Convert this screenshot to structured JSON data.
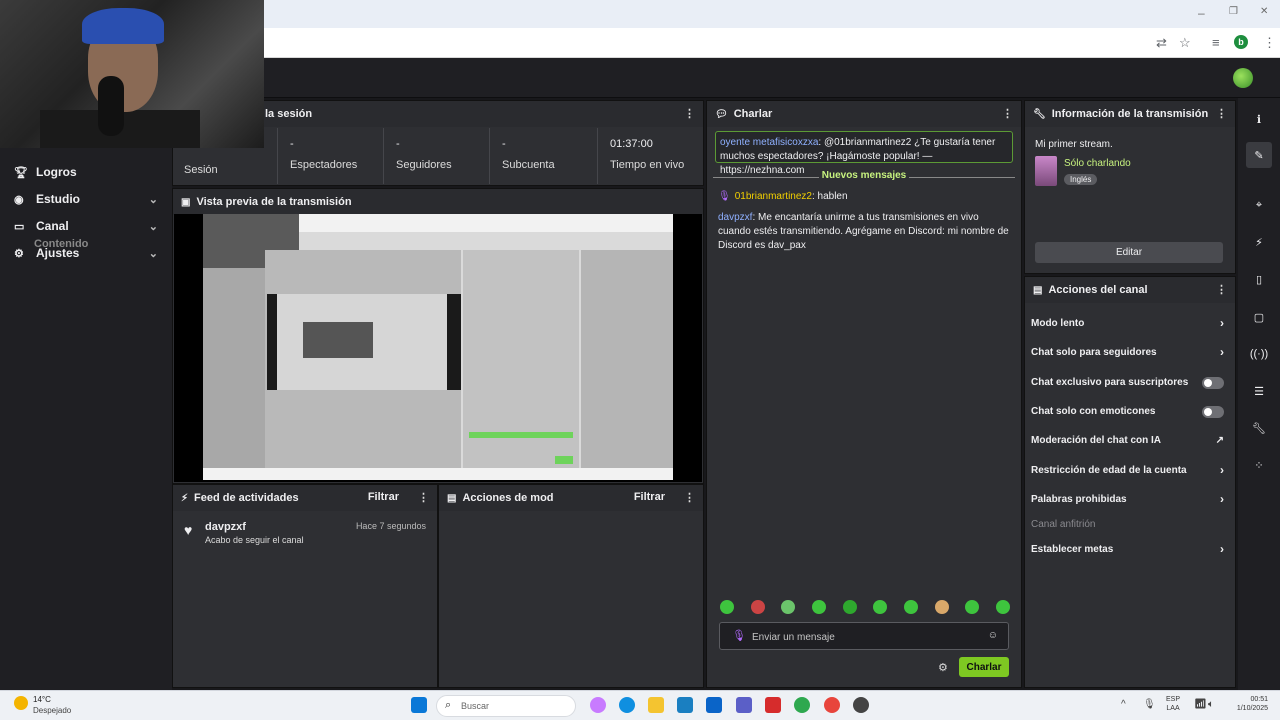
{
  "browser": {
    "window_controls": [
      "–",
      "❐",
      "✕"
    ],
    "profile_initial": "b"
  },
  "nav": {
    "cut_label": "Contenido",
    "items": [
      {
        "label": "Logros",
        "icon": "trophy-icon"
      },
      {
        "label": "Estudio",
        "icon": "studio-icon"
      },
      {
        "label": "Canal",
        "icon": "channel-icon"
      },
      {
        "label": "Ajustes",
        "icon": "gear-icon"
      }
    ]
  },
  "session": {
    "title": "la sesión",
    "stats": [
      {
        "value": "",
        "label": "Sesión"
      },
      {
        "value": "-",
        "label": "Espectadores"
      },
      {
        "value": "-",
        "label": "Seguidores"
      },
      {
        "value": "-",
        "label": "Subcuenta"
      },
      {
        "value": "01:37:00",
        "label": "Tiempo en vivo"
      }
    ]
  },
  "preview": {
    "title": "Vista previa de la transmisión"
  },
  "activity": {
    "title": "Feed de actividades",
    "filter": "Filtrar",
    "items": [
      {
        "user": "davpzxf",
        "desc": "Acabo de seguir el canal",
        "time": "Hace 7 segundos"
      }
    ]
  },
  "mod": {
    "title": "Acciones de mod",
    "filter": "Filtrar"
  },
  "chat": {
    "title": "Charlar",
    "pinned": {
      "user": "oyente metafisicoxzxa",
      "text": ": @01brianmartinez2 ¿Te gustaría tener muchos espectadores? ¡Hagámoste popular! — https://nezhna.com"
    },
    "new_messages_label": "Nuevos mensajes",
    "messages": [
      {
        "user": "01brianmartinez2",
        "text": ": hablen"
      },
      {
        "user": "davpzxf",
        "text": ": Me encantaría unirme a tus transmisiones en vivo cuando estés transmitiendo. Agrégame en Discord: mi nombre de Discord es dav_pax"
      }
    ],
    "input_placeholder": "Enviar un mensaje",
    "send_label": "Charlar"
  },
  "stream_info": {
    "title": "Información de la transmisión",
    "stream_title": "Mi primer stream.",
    "category": "Sólo charlando",
    "tag": "Inglés",
    "edit_label": "Editar"
  },
  "channel_actions": {
    "title": "Acciones del canal",
    "items": [
      {
        "label": "Modo lento",
        "control": "arrow"
      },
      {
        "label": "Chat solo para seguidores",
        "control": "arrow"
      },
      {
        "label": "Chat exclusivo para suscriptores",
        "control": "toggle"
      },
      {
        "label": "Chat solo con emoticones",
        "control": "toggle"
      },
      {
        "label": "Moderación del chat con IA",
        "control": "external"
      },
      {
        "label": "Restricción de edad de la cuenta",
        "control": "arrow"
      },
      {
        "label": "Palabras prohibidas",
        "control": "arrow"
      },
      {
        "label": "Canal anfitrión",
        "control": "none"
      },
      {
        "label": "Establecer metas",
        "control": "arrow"
      }
    ]
  },
  "taskbar": {
    "weather_temp": "14°C",
    "weather_desc": "Despejado",
    "search_placeholder": "Buscar",
    "lang_line1": "ESP",
    "lang_line2": "LAA",
    "time": "00:51",
    "date": "1/10/2025"
  },
  "colors": {
    "accent_green": "#7ec822",
    "chat_green": "#c7f27f",
    "panel_bg": "#2e2f33"
  }
}
